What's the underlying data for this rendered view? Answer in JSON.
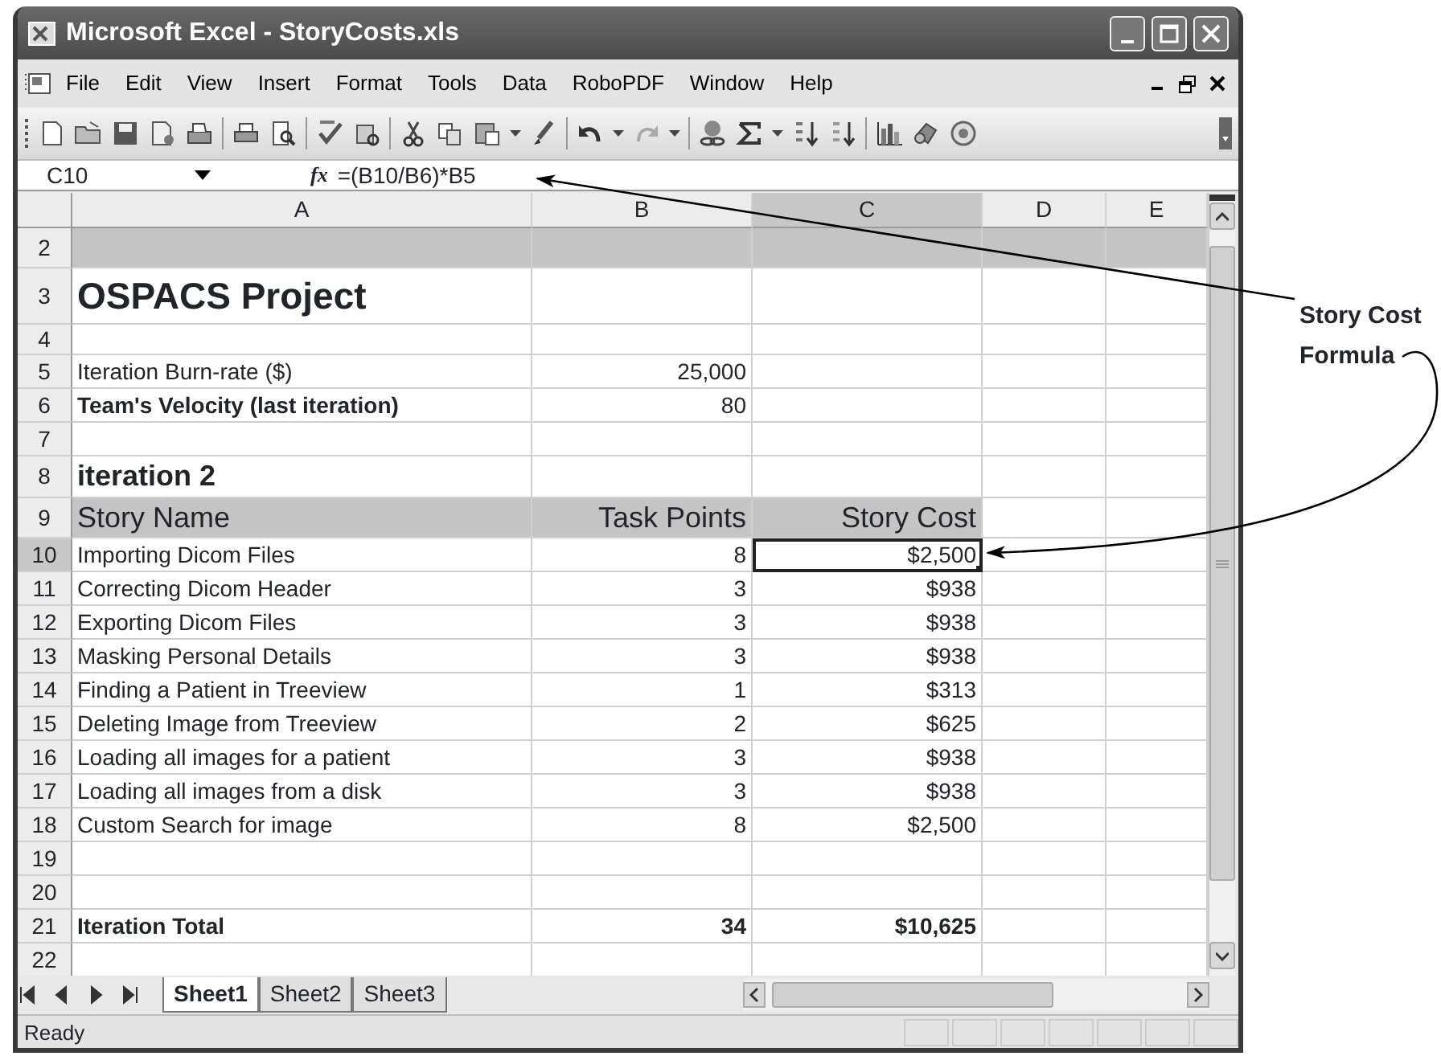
{
  "window": {
    "title": "Microsoft Excel - StoryCosts.xls"
  },
  "menu": [
    "File",
    "Edit",
    "View",
    "Insert",
    "Format",
    "Tools",
    "Data",
    "RoboPDF",
    "Window",
    "Help"
  ],
  "formula_bar": {
    "name_box": "C10",
    "fx_label": "fx",
    "formula": "=(B10/B6)*B5"
  },
  "columns": [
    {
      "label": "A",
      "selected": false
    },
    {
      "label": "B",
      "selected": false
    },
    {
      "label": "C",
      "selected": true
    },
    {
      "label": "D",
      "selected": false
    },
    {
      "label": "E",
      "selected": false
    }
  ],
  "rows": [
    {
      "number": "2",
      "kind": "band",
      "selected": false
    },
    {
      "number": "3",
      "kind": "title",
      "selected": false,
      "a": "OSPACS Project"
    },
    {
      "number": "4",
      "kind": "normal",
      "selected": false
    },
    {
      "number": "5",
      "kind": "normal",
      "selected": false,
      "a": "Iteration Burn-rate ($)",
      "b": "25,000"
    },
    {
      "number": "6",
      "kind": "emphasis",
      "selected": false,
      "a": "Team's Velocity (last iteration)",
      "b": "80"
    },
    {
      "number": "7",
      "kind": "normal",
      "selected": false
    },
    {
      "number": "8",
      "kind": "section",
      "selected": false,
      "a": "iteration 2"
    },
    {
      "number": "9",
      "kind": "header",
      "selected": false,
      "a": "Story Name",
      "b": "Task Points",
      "c": "Story Cost"
    },
    {
      "number": "10",
      "kind": "normal",
      "selected": true,
      "a": "Importing Dicom Files",
      "b": "8",
      "c": "$2,500"
    },
    {
      "number": "11",
      "kind": "normal",
      "selected": false,
      "a": "Correcting Dicom Header",
      "b": "3",
      "c": "$938"
    },
    {
      "number": "12",
      "kind": "normal",
      "selected": false,
      "a": "Exporting Dicom Files",
      "b": "3",
      "c": "$938"
    },
    {
      "number": "13",
      "kind": "normal",
      "selected": false,
      "a": "Masking Personal Details",
      "b": "3",
      "c": "$938"
    },
    {
      "number": "14",
      "kind": "normal",
      "selected": false,
      "a": "Finding a Patient in Treeview",
      "b": "1",
      "c": "$313"
    },
    {
      "number": "15",
      "kind": "normal",
      "selected": false,
      "a": "Deleting Image from Treeview",
      "b": "2",
      "c": "$625"
    },
    {
      "number": "16",
      "kind": "normal",
      "selected": false,
      "a": "Loading all images for a patient",
      "b": "3",
      "c": "$938"
    },
    {
      "number": "17",
      "kind": "normal",
      "selected": false,
      "a": "Loading all images from a disk",
      "b": "3",
      "c": "$938"
    },
    {
      "number": "18",
      "kind": "normal",
      "selected": false,
      "a": "Custom Search for image",
      "b": "8",
      "c": "$2,500"
    },
    {
      "number": "19",
      "kind": "normal",
      "selected": false
    },
    {
      "number": "20",
      "kind": "normal",
      "selected": false
    },
    {
      "number": "21",
      "kind": "total",
      "selected": false,
      "a": "Iteration Total",
      "b": "34",
      "c": "$10,625"
    },
    {
      "number": "22",
      "kind": "normal",
      "selected": false
    }
  ],
  "sheet_tabs": [
    {
      "label": "Sheet1",
      "selected": true
    },
    {
      "label": "Sheet2",
      "selected": false
    },
    {
      "label": "Sheet3",
      "selected": false
    }
  ],
  "status_bar": {
    "text": "Ready"
  },
  "callout": {
    "text": "Story Cost Formula"
  }
}
